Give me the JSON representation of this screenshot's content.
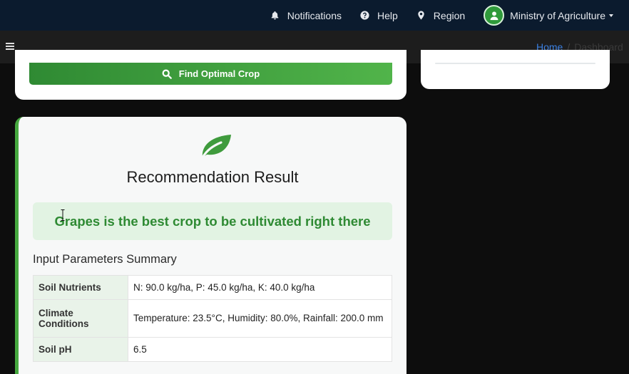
{
  "topbar": {
    "notifications_label": "Notifications",
    "help_label": "Help",
    "region_label": "Region",
    "user_label": "Ministry of Agriculture"
  },
  "subbar": {
    "breadcrumb_home": "Home",
    "breadcrumb_current": "Dashboard"
  },
  "form": {
    "submit_label": "Find Optimal Crop"
  },
  "result": {
    "icon": "leaf-icon",
    "title": "Recommendation Result",
    "message": "Grapes is the best crop to be cultivated right there",
    "summary_title": "Input Parameters Summary",
    "rows": [
      {
        "label": "Soil Nutrients",
        "value": "N: 90.0 kg/ha, P: 45.0 kg/ha, K: 40.0 kg/ha"
      },
      {
        "label": "Climate Conditions",
        "value": "Temperature: 23.5°C, Humidity: 80.0%, Rainfall: 200.0 mm"
      },
      {
        "label": "Soil pH",
        "value": "6.5"
      }
    ]
  },
  "colors": {
    "accent_green": "#46a83f",
    "topbar_bg": "#0b1b2e",
    "link_blue": "#3b7fe0"
  }
}
